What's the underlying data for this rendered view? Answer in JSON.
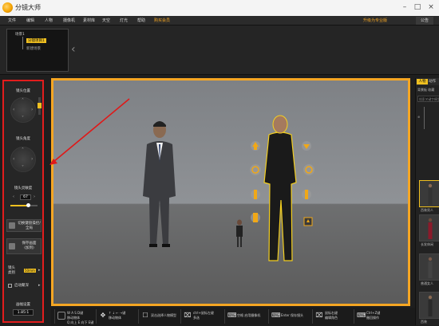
{
  "app": {
    "title": "分镜大师"
  },
  "window_controls": {
    "minimize": "–",
    "maximize": "□",
    "close": "×"
  },
  "menu": {
    "items": [
      "文件",
      "编辑",
      "人物",
      "摄像机",
      "素材库",
      "天空",
      "灯光",
      "帮助"
    ],
    "buy": "购买会员",
    "upgrade": "升级为专业版",
    "announce": "公告"
  },
  "shot_tree": {
    "scene": "场景1",
    "shot1": "分镜项目1",
    "shot2": "新建场景"
  },
  "left_panel": {
    "camera_position": "镜头位置",
    "camera_angle": "镜头角度",
    "sensitivity_label": "镜头灵敏度",
    "sensitivity_value": "67",
    "sensitivity_fraction": 0.67,
    "switch_fullscreen": "切换键盘操控/全局",
    "save_image_line1": "保存画面",
    "save_image_line2": "(加到)",
    "lens_line1": "镜头",
    "lens_line2": "类别",
    "lens_value": "50mm",
    "autofocus": "启动聚深",
    "focal_label": "画幅设置",
    "focal_value": "1.85:1"
  },
  "bottom_toolbar": [
    {
      "icon": "wasd-key-icon",
      "line1": "W A S D键",
      "line2": "移动物体",
      "line3": "Q 向上 E 向下  E键"
    },
    {
      "icon": "move-arrows-icon",
      "line1": "↑ ↓ ← →键",
      "line2": "移动物体"
    },
    {
      "icon": "click-icon",
      "line1": "双击选择人物模型",
      "line2": ""
    },
    {
      "icon": "mouse-icon",
      "line1": "ctrl+鼠标左键",
      "line2": "多选"
    },
    {
      "icon": "keyboard-icon",
      "line1": "空格  启用摄像机",
      "line2": ""
    },
    {
      "icon": "keyboard-icon",
      "line1": "Enter 保存镜头",
      "line2": ""
    },
    {
      "icon": "mouse-icon",
      "line1": "鼠标右键",
      "line2": "编辑角色"
    },
    {
      "icon": "keyboard-icon",
      "line1": "Ctrl+Z键",
      "line2": "撤回操作"
    }
  ],
  "right_panel": {
    "tab_person": "人物",
    "tab_action": "动作",
    "subtabs": "背景板   收藏",
    "search_placeholder": "搜索关键字模型",
    "thumb_labels": [
      "西装男人",
      "长发休闲",
      "普通女人",
      "西装"
    ]
  }
}
